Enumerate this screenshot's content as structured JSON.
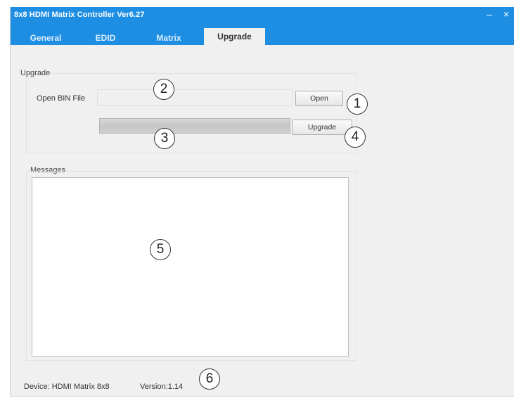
{
  "window": {
    "title": "8x8 HDMI Matrix Controller Ver6.27",
    "minimize_glyph": "–",
    "close_glyph": "×"
  },
  "tabs": [
    {
      "label": "General"
    },
    {
      "label": "EDID"
    },
    {
      "label": "Matrix"
    },
    {
      "label": "Upgrade",
      "active": true
    }
  ],
  "upgrade_group": {
    "label": "Upgrade",
    "open_bin_label": "Open BIN File",
    "file_path_value": "",
    "open_button": "Open",
    "upgrade_button": "Upgrade",
    "progress": 0
  },
  "messages_group": {
    "label": "Messages",
    "content": ""
  },
  "status_bar": {
    "device": "Device: HDMI Matrix 8x8",
    "version": "Version:1.14"
  },
  "callouts": [
    "1",
    "2",
    "3",
    "4",
    "5",
    "6"
  ],
  "colors": {
    "titlebar": "#1e8ee3",
    "window_bg": "#f0f0f0",
    "progress_fill": "#2fb34a"
  }
}
